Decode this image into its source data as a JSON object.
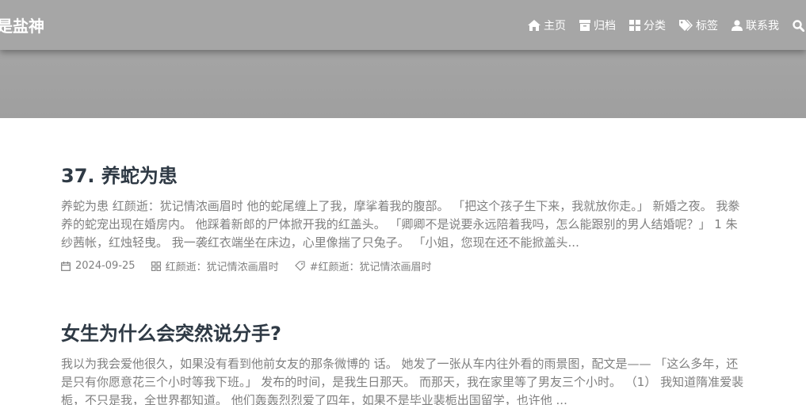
{
  "site": {
    "brand": "是盐神"
  },
  "nav": {
    "items": [
      {
        "label": "主页",
        "icon": "home-icon"
      },
      {
        "label": "归档",
        "icon": "archive-icon"
      },
      {
        "label": "分类",
        "icon": "category-icon"
      },
      {
        "label": "标签",
        "icon": "tag-icon"
      },
      {
        "label": "联系我",
        "icon": "user-icon"
      }
    ],
    "search_icon": "search-icon"
  },
  "posts": [
    {
      "title": "37. 养蛇为患",
      "excerpt": "养蛇为患 红颜逝：犹记情浓画眉时 他的蛇尾缠上了我，摩挲着我的腹部。 「把这个孩子生下来，我就放你走。」 新婚之夜。 我豢养的蛇宠出现在婚房内。 他踩着新郎的尸体掀开我的红盖头。 「卿卿不是说要永远陪着我吗，怎么能跟别的男人结婚呢？」 1 朱纱茜帐，红烛轻曳。 我一袭红衣端坐在床边，心里像揣了只兔子。 「小姐，您现在还不能掀盖头...",
      "date": "2024-09-25",
      "category": "红颜逝：犹记情浓画眉时",
      "tag": "#红颜逝：犹记情浓画眉时"
    },
    {
      "title": "女生为什么会突然说分手?",
      "excerpt": "我以为我会爱他很久，如果没有看到他前女友的那条微博的 话。 她发了一张从车内往外看的雨景图，配文是—— 「这么多年，还是只有你愿意花三个小时等我下班。」 发布的时间，是我生日那天。 而那天，我在家里等了男友三个小时。 （1） 我知道隋准爱裴栀，不只是我，全世界都知道。 他们轰轰烈烈爱了四年，如果不是毕业裴栀出国留学，也许他 ..."
    }
  ]
}
